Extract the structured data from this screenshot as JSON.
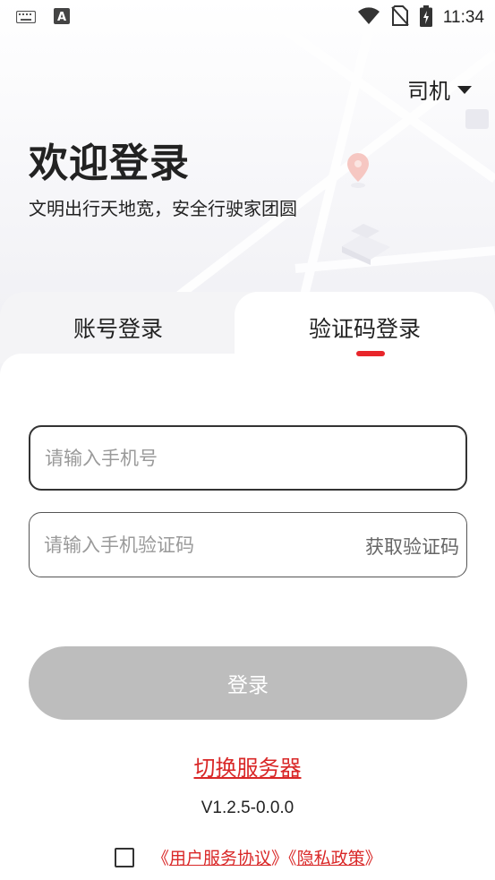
{
  "status_bar": {
    "time": "11:34",
    "left_icons": [
      "keyboard-icon",
      "font-a-icon"
    ],
    "right_icons": [
      "wifi-icon",
      "no-sim-icon",
      "battery-charging-icon"
    ]
  },
  "header": {
    "role_selector": "司机",
    "title": "欢迎登录",
    "subtitle": "文明出行天地宽，安全行驶家团圆"
  },
  "tabs": [
    {
      "label": "账号登录",
      "active": false
    },
    {
      "label": "验证码登录",
      "active": true
    }
  ],
  "form": {
    "phone_placeholder": "请输入手机号",
    "phone_value": "",
    "code_placeholder": "请输入手机验证码",
    "code_value": "",
    "get_code_label": "获取验证码",
    "login_label": "登录"
  },
  "footer": {
    "switch_server": "切换服务器",
    "version": "V1.2.5-0.0.0",
    "open_quote1": "《",
    "user_agreement": "用户服务协议",
    "close_quote1": "》",
    "open_quote2": "《",
    "privacy_policy": "隐私政策",
    "close_quote2": "》",
    "agree_checked": false
  },
  "colors": {
    "accent": "#e8262b",
    "link": "#d92727",
    "button_disabled": "#bdbdbd"
  }
}
